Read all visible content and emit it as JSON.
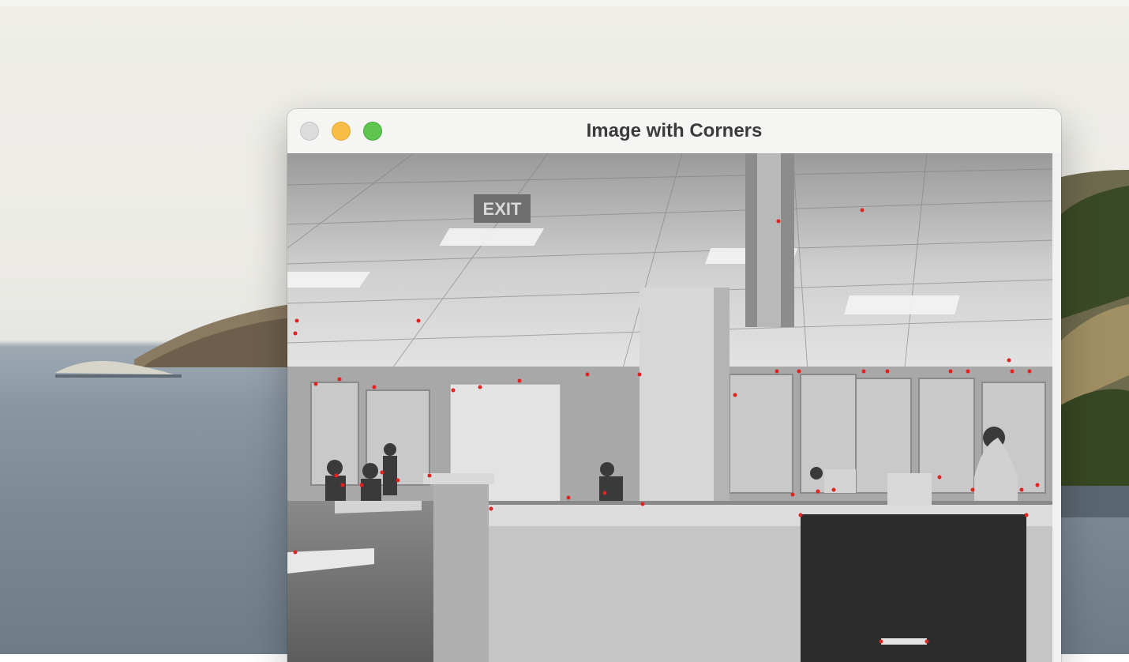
{
  "window": {
    "title": "Image with Corners",
    "buttons": {
      "close": "close-button",
      "minimize": "minimize-button",
      "zoom": "zoom-button"
    }
  },
  "image": {
    "description_icon": "photo-icon",
    "exit_sign_text": "EXIT",
    "marker_color": "#e0231d",
    "grayscale": true
  },
  "colors": {
    "traffic_close": "#dcdcdc",
    "traffic_minimize": "#f7bd44",
    "traffic_zoom": "#5ec54f"
  }
}
